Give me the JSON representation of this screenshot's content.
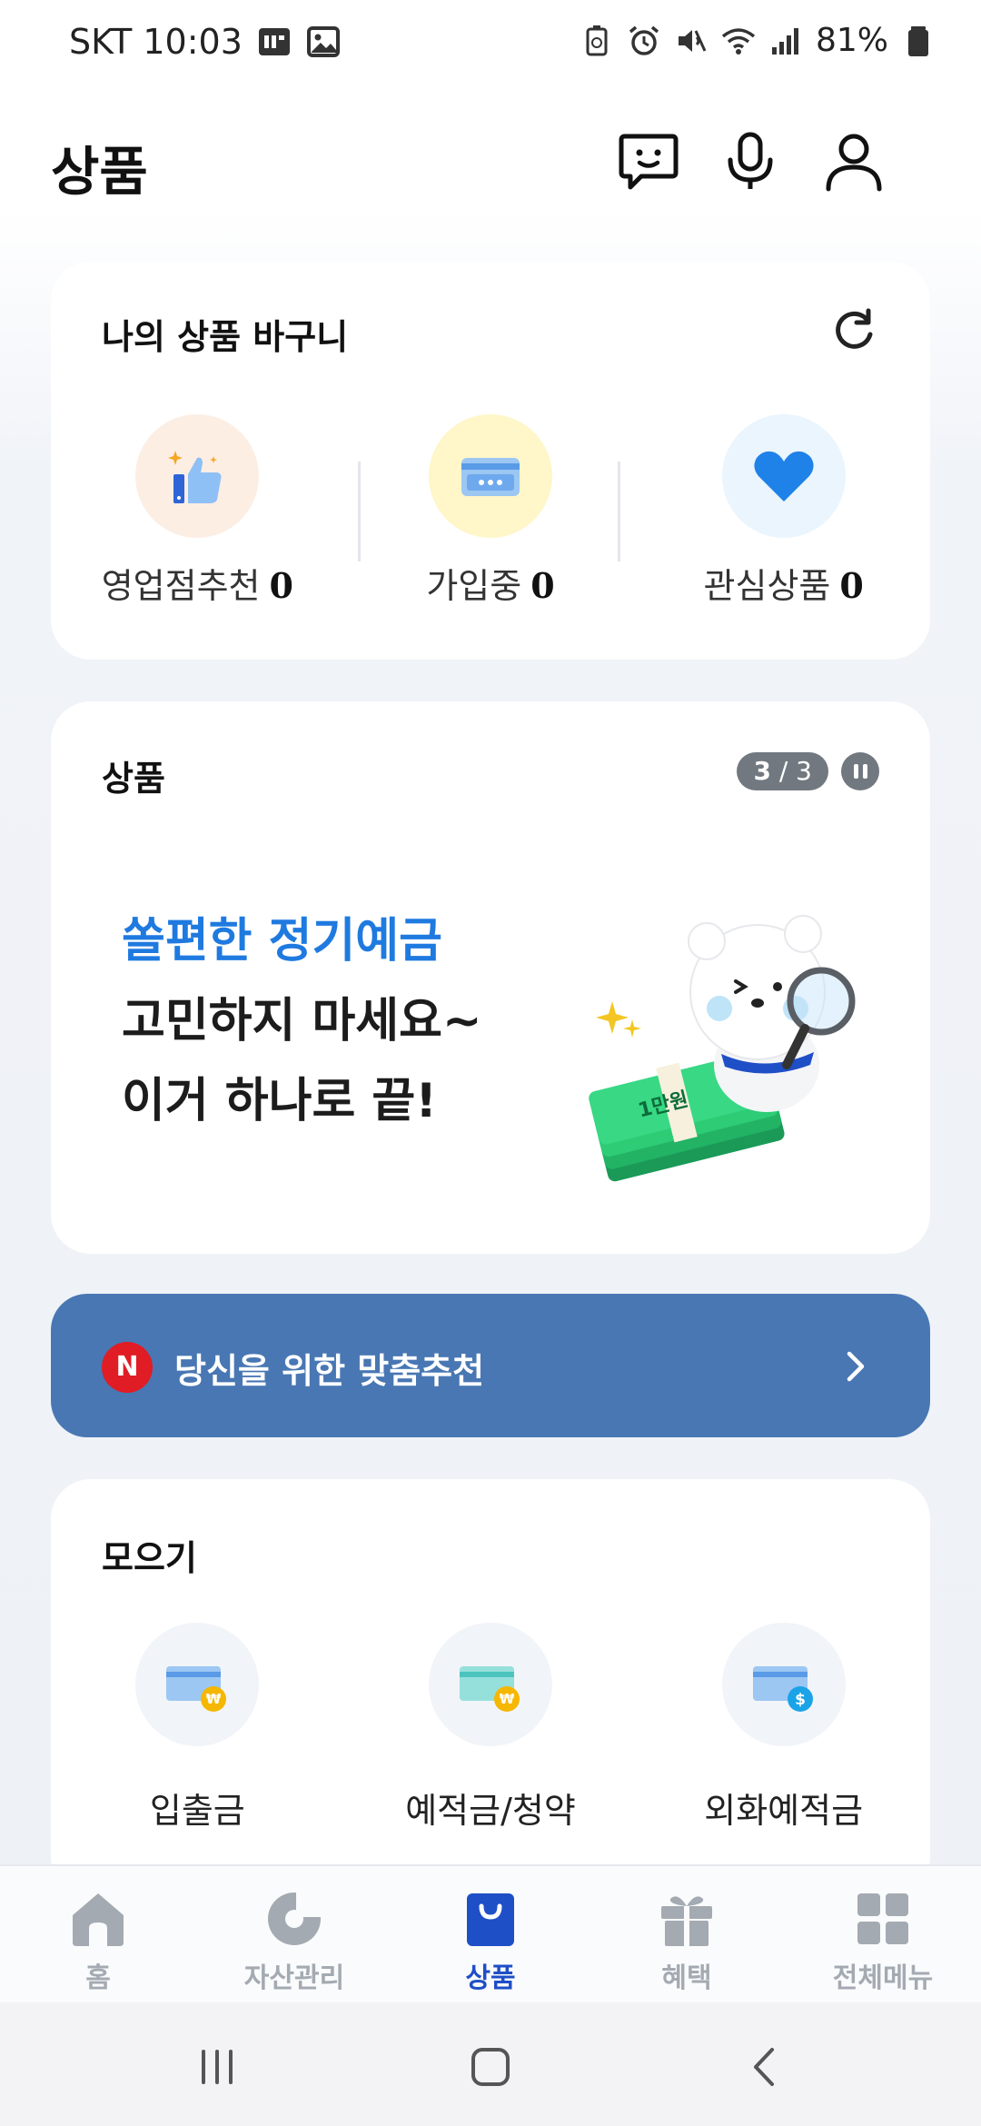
{
  "status_bar": {
    "carrier_time": "SKT 10:03",
    "battery_text": "81%"
  },
  "header": {
    "title": "상품"
  },
  "basket": {
    "title": "나의 상품 바구니",
    "items": [
      {
        "label": "영업점추천",
        "count": "0"
      },
      {
        "label": "가입중",
        "count": "0"
      },
      {
        "label": "관심상품",
        "count": "0"
      }
    ]
  },
  "product": {
    "title": "상품",
    "pager_current": "3",
    "pager_sep": " / ",
    "pager_total": "3",
    "line1": "쏠편한 정기예금",
    "line2": "고민하지 마세요~",
    "line3": "이거 하나로 끝!",
    "money_text": "1만원"
  },
  "reco": {
    "badge": "N",
    "label": "당신을 위한 맞춤추천"
  },
  "savings": {
    "title": "모으기",
    "items": [
      {
        "label": "입출금"
      },
      {
        "label": "예적금/청약"
      },
      {
        "label": "외화예적금"
      }
    ]
  },
  "tabs": [
    {
      "label": "홈"
    },
    {
      "label": "자산관리"
    },
    {
      "label": "상품"
    },
    {
      "label": "혜택"
    },
    {
      "label": "전체메뉴"
    }
  ],
  "colors": {
    "accent": "#1f4fc7",
    "banner_blue": "#1f7ae0",
    "reco_bg": "#4877b3",
    "badge_red": "#e01c24"
  }
}
